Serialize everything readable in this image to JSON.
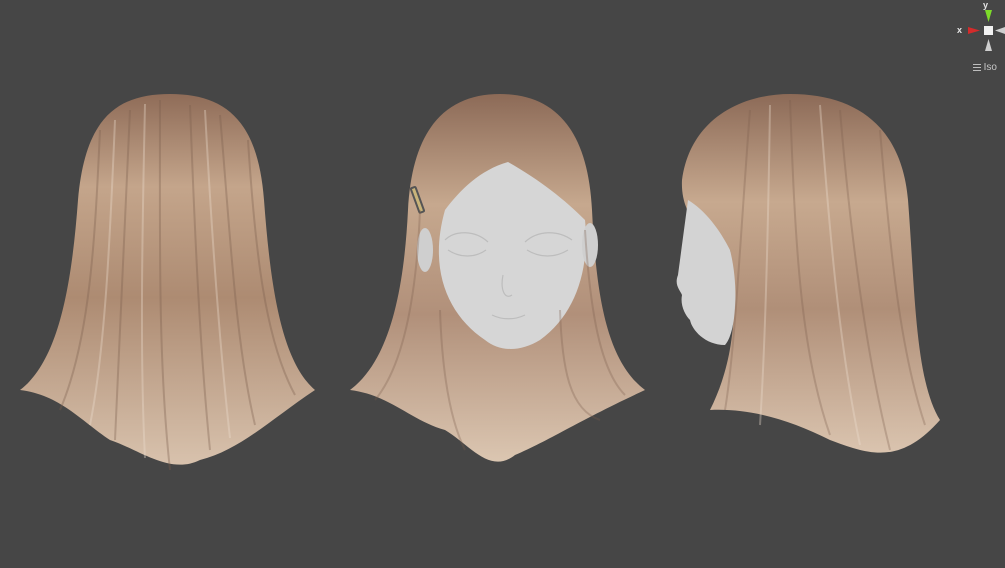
{
  "viewport": {
    "background_color": "#464646",
    "views": [
      "back-view",
      "front-view",
      "side-view"
    ]
  },
  "gizmo": {
    "x_label": "x",
    "y_label": "y",
    "x_color": "#d42b2b",
    "y_color": "#7ddc2a",
    "neutral_color": "#cfcfcf"
  },
  "projection": {
    "label": "Iso",
    "icon": "hamburger-menu-icon"
  },
  "colors": {
    "hair_light": "#d3b9a1",
    "hair_mid": "#ba9a80",
    "hair_dark": "#8f6c58",
    "skin": "#d6d6d6"
  }
}
